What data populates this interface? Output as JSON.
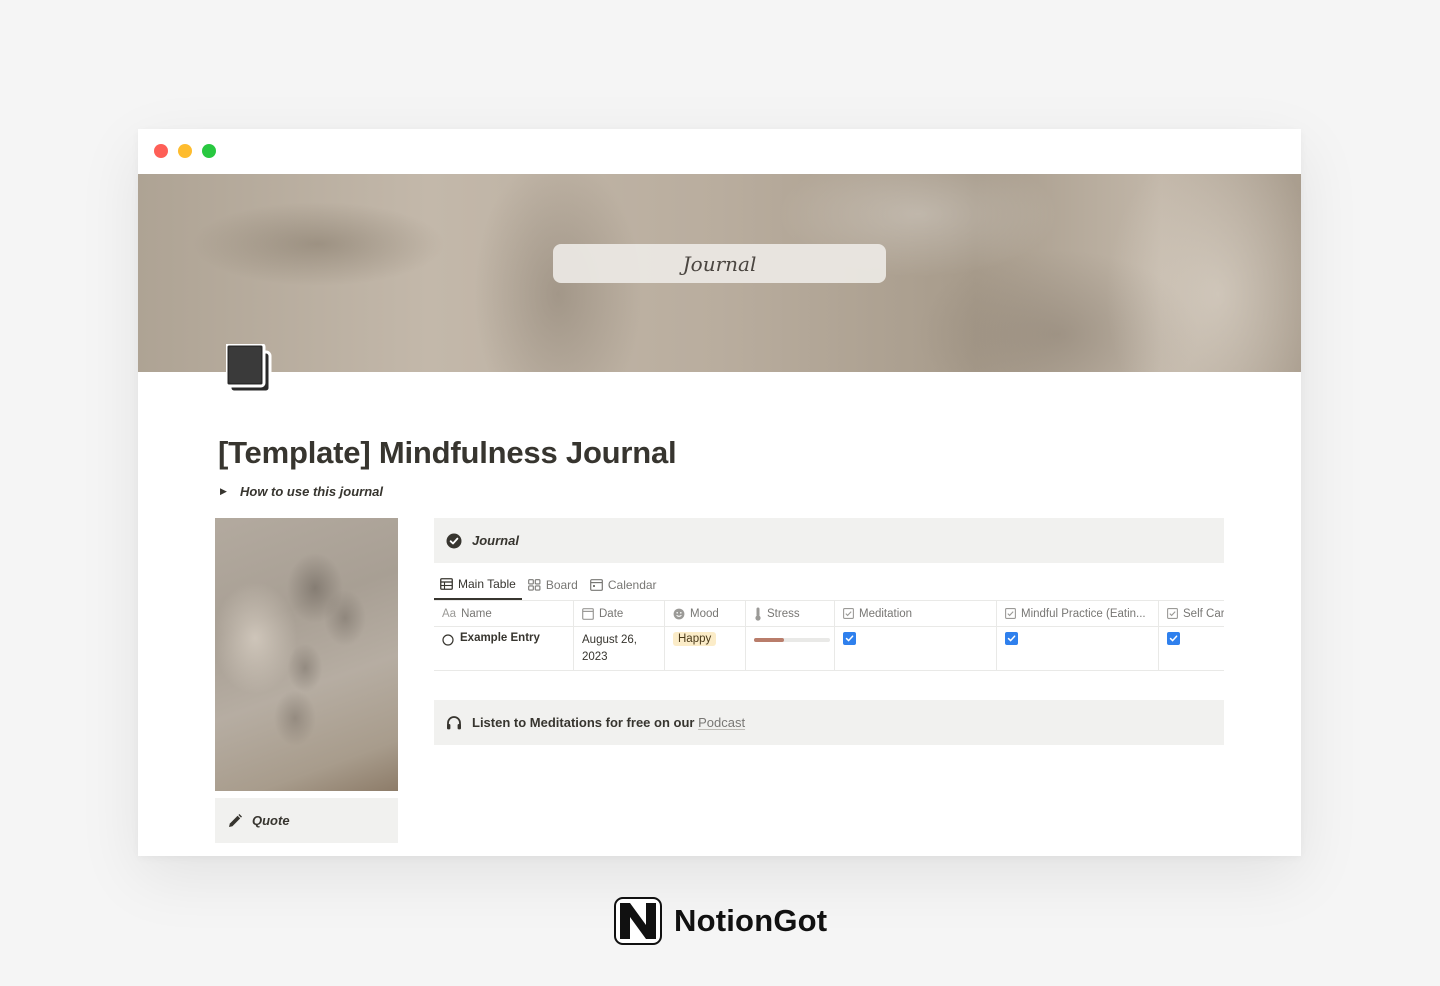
{
  "window": {
    "controls": [
      "close",
      "minimize",
      "zoom"
    ]
  },
  "cover": {
    "label": "Journal"
  },
  "page": {
    "icon": "book-icon",
    "title": "[Template] Mindfulness Journal",
    "toggle": {
      "label": "How to use this journal",
      "icon": "triangle-right-icon"
    }
  },
  "sidebar": {
    "quote_label": "Quote",
    "quote_icon": "pencil-icon"
  },
  "journal": {
    "callout_label": "Journal",
    "callout_icon": "check-circle-icon",
    "tabs": [
      {
        "label": "Main Table",
        "icon": "table-icon",
        "active": true
      },
      {
        "label": "Board",
        "icon": "board-icon",
        "active": false
      },
      {
        "label": "Calendar",
        "icon": "calendar-icon",
        "active": false
      }
    ],
    "columns": [
      {
        "label": "Name",
        "prefix": "Aa"
      },
      {
        "label": "Date",
        "icon": "calendar-icon"
      },
      {
        "label": "Mood",
        "icon": "smile-icon"
      },
      {
        "label": "Stress",
        "icon": "thermometer-icon"
      },
      {
        "label": "Meditation",
        "icon": "checkbox-icon"
      },
      {
        "label": "Mindful Practice (Eatin...",
        "icon": "checkbox-icon"
      },
      {
        "label": "Self Car",
        "icon": "checkbox-icon"
      }
    ],
    "rows": [
      {
        "name": "Example Entry",
        "date_line1": "August 26,",
        "date_line2": "2023",
        "mood": "Happy",
        "stress_level": 0.4,
        "meditation": true,
        "mindful_practice": true,
        "self_care": true
      }
    ]
  },
  "podcast": {
    "icon": "headphones-icon",
    "text": "Listen to Meditations for free on our",
    "link": "Podcast"
  },
  "brand": {
    "name": "NotionGot",
    "logo_letter": "N"
  },
  "colors": {
    "checkbox": "#2f80ed",
    "mood_tag": "#fbecc8",
    "stress_fill": "#b97d6b",
    "callout_bg": "#f1f1ef"
  }
}
